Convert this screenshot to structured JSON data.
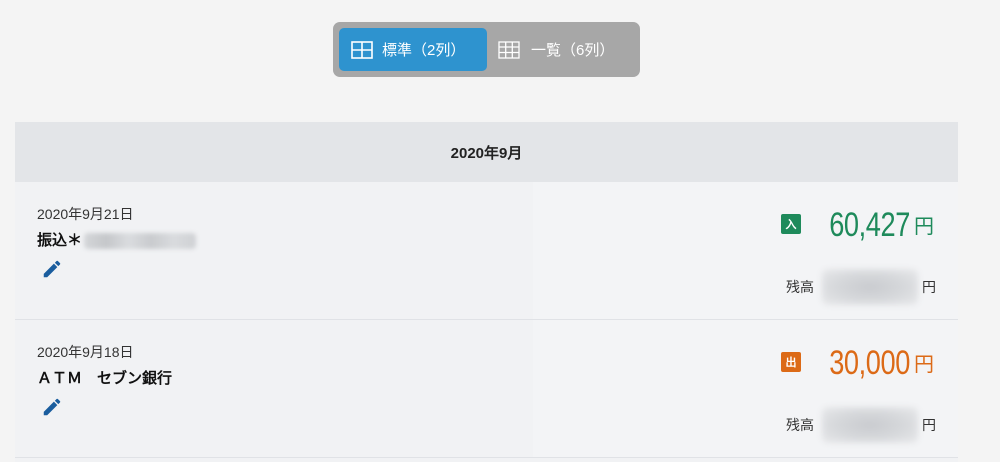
{
  "view_toggle": {
    "standard_label": "標準（2列）",
    "list_label": "一覧（6列）",
    "active": "standard"
  },
  "colors": {
    "accent": "#2e93cf",
    "deposit": "#1e8a5b",
    "withdrawal": "#dc6a17"
  },
  "month_header": "2020年9月",
  "transactions": [
    {
      "date": "2020年9月21日",
      "description": "振込＊",
      "type_badge": "入",
      "amount": "60,427",
      "currency": "円",
      "balance_label": "残高",
      "balance_currency": "円"
    },
    {
      "date": "2020年9月18日",
      "description": "ＡＴＭ　セブン銀行",
      "type_badge": "出",
      "amount": "30,000",
      "currency": "円",
      "balance_label": "残高",
      "balance_currency": "円"
    }
  ]
}
